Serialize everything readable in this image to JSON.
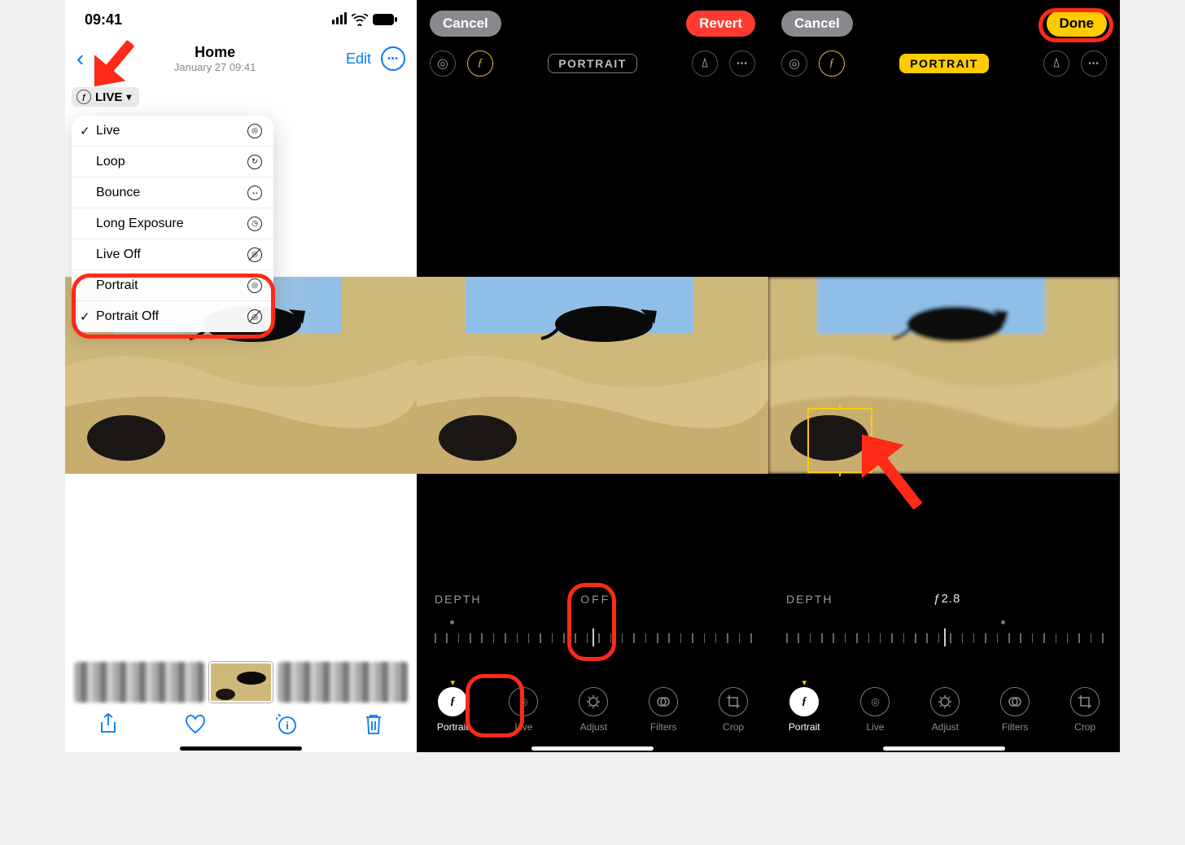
{
  "screen1": {
    "status": {
      "time": "09:41"
    },
    "nav": {
      "title": "Home",
      "subtitle": "January 27  09:41",
      "edit": "Edit"
    },
    "liveBadge": "LIVE",
    "menu": [
      {
        "label": "Live",
        "checked": true,
        "icon": "live-icon"
      },
      {
        "label": "Loop",
        "checked": false,
        "icon": "loop-icon"
      },
      {
        "label": "Bounce",
        "checked": false,
        "icon": "bounce-icon"
      },
      {
        "label": "Long Exposure",
        "checked": false,
        "icon": "exposure-icon"
      },
      {
        "label": "Live Off",
        "checked": false,
        "icon": "live-off-icon"
      },
      {
        "label": "Portrait",
        "checked": false,
        "icon": "portrait-icon"
      },
      {
        "label": "Portrait Off",
        "checked": true,
        "icon": "portrait-off-icon"
      }
    ]
  },
  "screen2": {
    "cancel": "Cancel",
    "revert": "Revert",
    "mode": "PORTRAIT",
    "depthLabel": "DEPTH",
    "depthValue": "OFF",
    "tabs": [
      {
        "label": "Portrait",
        "active": true
      },
      {
        "label": "Live"
      },
      {
        "label": "Adjust"
      },
      {
        "label": "Filters"
      },
      {
        "label": "Crop"
      }
    ]
  },
  "screen3": {
    "cancel": "Cancel",
    "done": "Done",
    "mode": "PORTRAIT",
    "depthLabel": "DEPTH",
    "depthValue": "ƒ2.8",
    "tabs": [
      {
        "label": "Portrait",
        "active": true
      },
      {
        "label": "Live"
      },
      {
        "label": "Adjust"
      },
      {
        "label": "Filters"
      },
      {
        "label": "Crop"
      }
    ]
  },
  "colors": {
    "blue": "#007aff",
    "red": "#ff3b30",
    "yellow": "#ffcc00",
    "annot": "#ff2a17"
  }
}
